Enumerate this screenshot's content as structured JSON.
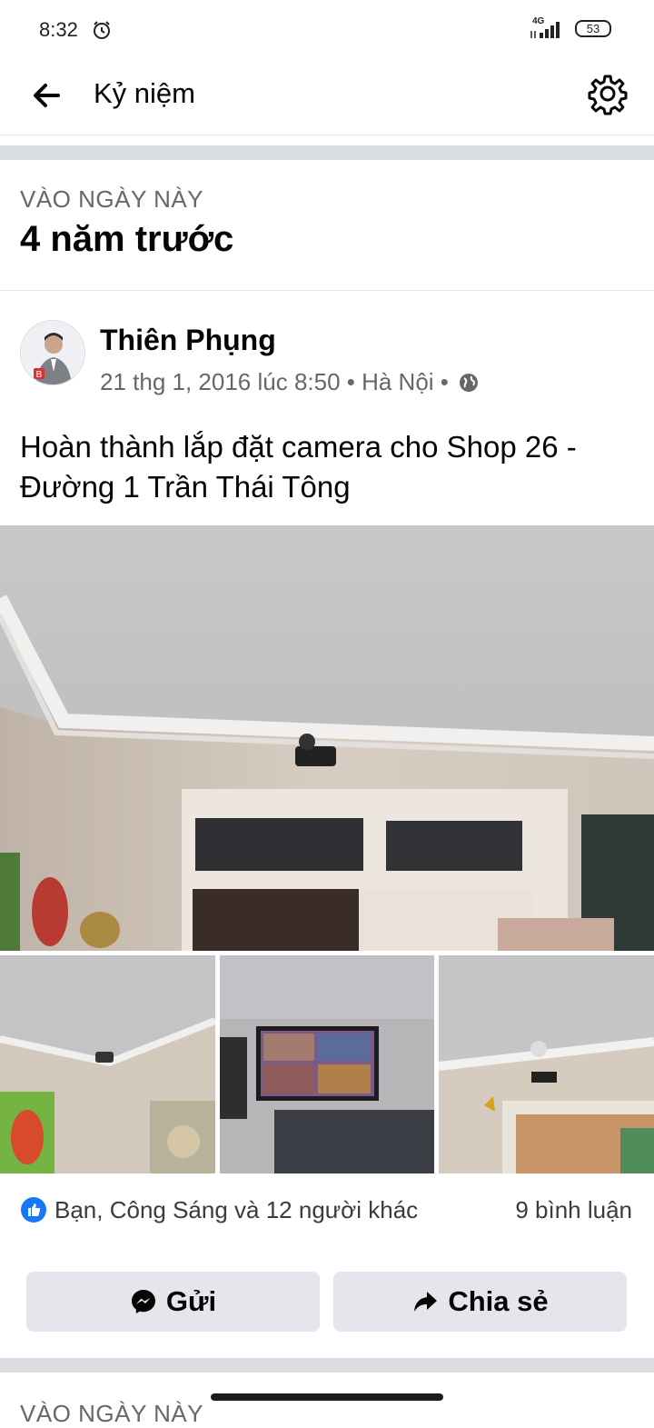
{
  "status": {
    "time": "8:32",
    "network": "4G",
    "battery": "53"
  },
  "appbar": {
    "title": "Kỷ niệm"
  },
  "memory": {
    "section_label": "VÀO NGÀY NÀY",
    "section_title": "4 năm trước",
    "author": "Thiên Phụng",
    "meta": "21 thg 1, 2016 lúc 8:50 • Hà Nội •",
    "text": "Hoàn thành lắp đặt camera cho Shop 26 - Đường 1 Trần Thái Tông",
    "reactions": "Bạn, Công Sáng và 12 người khác",
    "comments": "9 bình luận",
    "send_label": "Gửi",
    "share_label": "Chia sẻ"
  },
  "next_section_label": "VÀO NGÀY NÀY",
  "colors": {
    "accent": "#1877f2",
    "button_bg": "#e4e6eb",
    "secondary_text": "#65676b"
  }
}
